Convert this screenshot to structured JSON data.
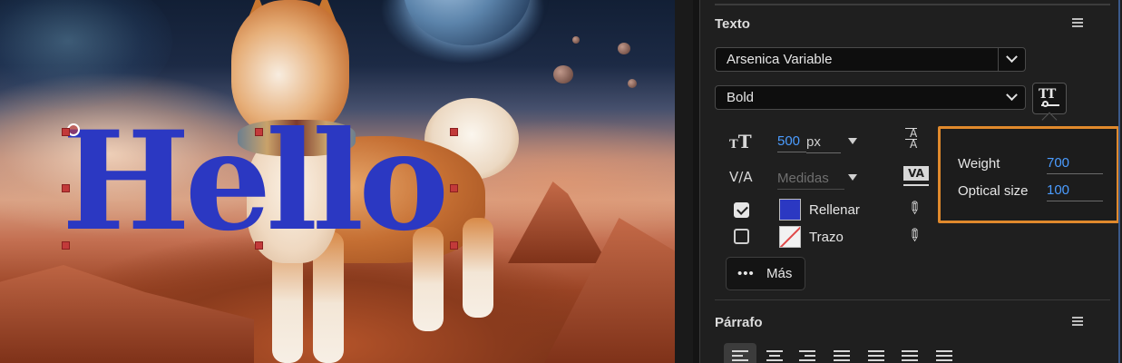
{
  "canvas": {
    "text_layer": "Hello",
    "text_color": "#2b38c2",
    "handle_color": "#c23a3a"
  },
  "text_panel": {
    "title": "Texto",
    "font_family": "Arsenica Variable",
    "font_style": "Bold",
    "font_size_value": "500",
    "font_size_unit": "px",
    "tracking_value": "Medidas",
    "fill_label": "Rellenar",
    "fill_checked": true,
    "fill_color": "#2b38c2",
    "stroke_label": "Trazo",
    "stroke_checked": false,
    "more_label": "Más",
    "variable_axes": {
      "weight_label": "Weight",
      "weight_value": "700",
      "optical_label": "Optical size",
      "optical_value": "100"
    },
    "highlight_color": "#e0892c"
  },
  "paragraph_panel": {
    "title": "Párrafo"
  },
  "icons": {
    "menu": "hamburger-icon",
    "chevron": "chevron-down-icon",
    "variable_font": "variable-font-icon",
    "font_size": "font-size-icon",
    "leading": "leading-icon",
    "kerning": "kerning-icon",
    "tracking": "tracking-icon",
    "eyedropper": "eyedropper-icon",
    "more": "ellipsis-icon"
  }
}
